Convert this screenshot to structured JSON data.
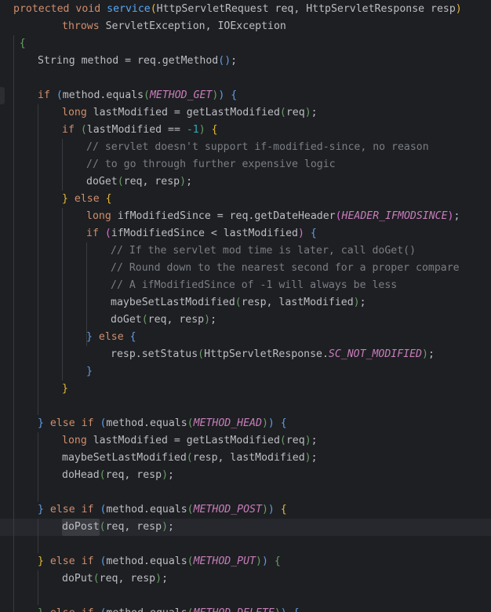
{
  "editor": {
    "language": "Java",
    "theme": "dark",
    "colors": {
      "background": "#1e1f22",
      "keyword": "#cf8e6d",
      "method_decl": "#56a8f5",
      "constant": "#c77dbb",
      "comment": "#7a7e85",
      "number": "#2aacb8",
      "text": "#bcbec4"
    },
    "caret_line": 31,
    "lines": [
      {
        "indent": 0,
        "tokens": [
          {
            "t": "protected",
            "s": "kw"
          },
          {
            "t": " ",
            "s": "tx"
          },
          {
            "t": "void",
            "s": "kw"
          },
          {
            "t": " ",
            "s": "tx"
          },
          {
            "t": "service",
            "s": "fn"
          },
          {
            "t": "(",
            "s": "b1"
          },
          {
            "t": "HttpServletRequest req, HttpServletResponse resp",
            "s": "tx"
          },
          {
            "t": ")",
            "s": "b1"
          }
        ]
      },
      {
        "indent": 8,
        "tokens": [
          {
            "t": "throws",
            "s": "kw"
          },
          {
            "t": " ServletException, IOException",
            "s": "tx"
          }
        ]
      },
      {
        "indent": 1,
        "tokens": [
          {
            "t": "{",
            "s": "b3"
          }
        ]
      },
      {
        "indent": 4,
        "tokens": [
          {
            "t": "String method = req.getMethod",
            "s": "tx"
          },
          {
            "t": "()",
            "s": "b2"
          },
          {
            "t": ";",
            "s": "tx"
          }
        ]
      },
      {
        "indent": 0,
        "tokens": []
      },
      {
        "indent": 4,
        "tokens": [
          {
            "t": "if",
            "s": "kw"
          },
          {
            "t": " ",
            "s": "tx"
          },
          {
            "t": "(",
            "s": "b2"
          },
          {
            "t": "method.equals",
            "s": "tx"
          },
          {
            "t": "(",
            "s": "b3"
          },
          {
            "t": "METHOD_GET",
            "s": "cn"
          },
          {
            "t": ")",
            "s": "b3"
          },
          {
            "t": ")",
            "s": "b2"
          },
          {
            "t": " ",
            "s": "tx"
          },
          {
            "t": "{",
            "s": "b2"
          }
        ]
      },
      {
        "indent": 8,
        "tokens": [
          {
            "t": "long",
            "s": "kw"
          },
          {
            "t": " lastModified = getLastModified",
            "s": "tx"
          },
          {
            "t": "(",
            "s": "b3"
          },
          {
            "t": "req",
            "s": "tx"
          },
          {
            "t": ")",
            "s": "b3"
          },
          {
            "t": ";",
            "s": "tx"
          }
        ]
      },
      {
        "indent": 8,
        "tokens": [
          {
            "t": "if",
            "s": "kw"
          },
          {
            "t": " ",
            "s": "tx"
          },
          {
            "t": "(",
            "s": "b3"
          },
          {
            "t": "lastModified == ",
            "s": "tx"
          },
          {
            "t": "-1",
            "s": "nm"
          },
          {
            "t": ")",
            "s": "b3"
          },
          {
            "t": " ",
            "s": "tx"
          },
          {
            "t": "{",
            "s": "b1"
          }
        ]
      },
      {
        "indent": 12,
        "tokens": [
          {
            "t": "// servlet doesn't support if-modified-since, no reason",
            "s": "cm"
          }
        ]
      },
      {
        "indent": 12,
        "tokens": [
          {
            "t": "// to go through further expensive logic",
            "s": "cm"
          }
        ]
      },
      {
        "indent": 12,
        "tokens": [
          {
            "t": "doGet",
            "s": "tx"
          },
          {
            "t": "(",
            "s": "b3"
          },
          {
            "t": "req, resp",
            "s": "tx"
          },
          {
            "t": ")",
            "s": "b3"
          },
          {
            "t": ";",
            "s": "tx"
          }
        ]
      },
      {
        "indent": 8,
        "tokens": [
          {
            "t": "}",
            "s": "b1"
          },
          {
            "t": " ",
            "s": "tx"
          },
          {
            "t": "else",
            "s": "kw"
          },
          {
            "t": " ",
            "s": "tx"
          },
          {
            "t": "{",
            "s": "b1"
          }
        ]
      },
      {
        "indent": 12,
        "tokens": [
          {
            "t": "long",
            "s": "kw"
          },
          {
            "t": " ifModifiedSince = req.getDateHeader",
            "s": "tx"
          },
          {
            "t": "(",
            "s": "b4"
          },
          {
            "t": "HEADER_IFMODSINCE",
            "s": "cn"
          },
          {
            "t": ")",
            "s": "b4"
          },
          {
            "t": ";",
            "s": "tx"
          }
        ]
      },
      {
        "indent": 12,
        "tokens": [
          {
            "t": "if",
            "s": "kw"
          },
          {
            "t": " ",
            "s": "tx"
          },
          {
            "t": "(",
            "s": "b4"
          },
          {
            "t": "ifModifiedSince < lastModified",
            "s": "tx"
          },
          {
            "t": ")",
            "s": "b4"
          },
          {
            "t": " ",
            "s": "tx"
          },
          {
            "t": "{",
            "s": "b2"
          }
        ]
      },
      {
        "indent": 16,
        "tokens": [
          {
            "t": "// If the servlet mod time is later, call doGet()",
            "s": "cm"
          }
        ]
      },
      {
        "indent": 16,
        "tokens": [
          {
            "t": "// Round down to the nearest second for a proper compare",
            "s": "cm"
          }
        ]
      },
      {
        "indent": 16,
        "tokens": [
          {
            "t": "// A ifModifiedSince of -1 will always be less",
            "s": "cm"
          }
        ]
      },
      {
        "indent": 16,
        "tokens": [
          {
            "t": "maybeSetLastModified",
            "s": "tx"
          },
          {
            "t": "(",
            "s": "b3"
          },
          {
            "t": "resp, lastModified",
            "s": "tx"
          },
          {
            "t": ")",
            "s": "b3"
          },
          {
            "t": ";",
            "s": "tx"
          }
        ]
      },
      {
        "indent": 16,
        "tokens": [
          {
            "t": "doGet",
            "s": "tx"
          },
          {
            "t": "(",
            "s": "b3"
          },
          {
            "t": "req, resp",
            "s": "tx"
          },
          {
            "t": ")",
            "s": "b3"
          },
          {
            "t": ";",
            "s": "tx"
          }
        ]
      },
      {
        "indent": 12,
        "tokens": [
          {
            "t": "}",
            "s": "b2"
          },
          {
            "t": " ",
            "s": "tx"
          },
          {
            "t": "else",
            "s": "kw"
          },
          {
            "t": " ",
            "s": "tx"
          },
          {
            "t": "{",
            "s": "b2"
          }
        ]
      },
      {
        "indent": 16,
        "tokens": [
          {
            "t": "resp.setStatus",
            "s": "tx"
          },
          {
            "t": "(",
            "s": "b3"
          },
          {
            "t": "HttpServletResponse.",
            "s": "tx"
          },
          {
            "t": "SC_NOT_MODIFIED",
            "s": "cn"
          },
          {
            "t": ")",
            "s": "b3"
          },
          {
            "t": ";",
            "s": "tx"
          }
        ]
      },
      {
        "indent": 12,
        "tokens": [
          {
            "t": "}",
            "s": "b2"
          }
        ]
      },
      {
        "indent": 8,
        "tokens": [
          {
            "t": "}",
            "s": "b1"
          }
        ]
      },
      {
        "indent": 0,
        "tokens": []
      },
      {
        "indent": 4,
        "tokens": [
          {
            "t": "}",
            "s": "b2"
          },
          {
            "t": " ",
            "s": "tx"
          },
          {
            "t": "else",
            "s": "kw"
          },
          {
            "t": " ",
            "s": "tx"
          },
          {
            "t": "if",
            "s": "kw"
          },
          {
            "t": " ",
            "s": "tx"
          },
          {
            "t": "(",
            "s": "b2"
          },
          {
            "t": "method.equals",
            "s": "tx"
          },
          {
            "t": "(",
            "s": "b3"
          },
          {
            "t": "METHOD_HEAD",
            "s": "cn"
          },
          {
            "t": ")",
            "s": "b3"
          },
          {
            "t": ")",
            "s": "b2"
          },
          {
            "t": " ",
            "s": "tx"
          },
          {
            "t": "{",
            "s": "b2"
          }
        ]
      },
      {
        "indent": 8,
        "tokens": [
          {
            "t": "long",
            "s": "kw"
          },
          {
            "t": " lastModified = getLastModified",
            "s": "tx"
          },
          {
            "t": "(",
            "s": "b3"
          },
          {
            "t": "req",
            "s": "tx"
          },
          {
            "t": ")",
            "s": "b3"
          },
          {
            "t": ";",
            "s": "tx"
          }
        ]
      },
      {
        "indent": 8,
        "tokens": [
          {
            "t": "maybeSetLastModified",
            "s": "tx"
          },
          {
            "t": "(",
            "s": "b3"
          },
          {
            "t": "resp, lastModified",
            "s": "tx"
          },
          {
            "t": ")",
            "s": "b3"
          },
          {
            "t": ";",
            "s": "tx"
          }
        ]
      },
      {
        "indent": 8,
        "tokens": [
          {
            "t": "doHead",
            "s": "tx"
          },
          {
            "t": "(",
            "s": "b3"
          },
          {
            "t": "req, resp",
            "s": "tx"
          },
          {
            "t": ")",
            "s": "b3"
          },
          {
            "t": ";",
            "s": "tx"
          }
        ]
      },
      {
        "indent": 0,
        "tokens": []
      },
      {
        "indent": 4,
        "tokens": [
          {
            "t": "}",
            "s": "b2"
          },
          {
            "t": " ",
            "s": "tx"
          },
          {
            "t": "else",
            "s": "kw"
          },
          {
            "t": " ",
            "s": "tx"
          },
          {
            "t": "if",
            "s": "kw"
          },
          {
            "t": " ",
            "s": "tx"
          },
          {
            "t": "(",
            "s": "b2"
          },
          {
            "t": "method.equals",
            "s": "tx"
          },
          {
            "t": "(",
            "s": "b3"
          },
          {
            "t": "METHOD_POST",
            "s": "cn"
          },
          {
            "t": ")",
            "s": "b3"
          },
          {
            "t": ")",
            "s": "b2"
          },
          {
            "t": " ",
            "s": "tx"
          },
          {
            "t": "{",
            "s": "b1"
          }
        ]
      },
      {
        "indent": 8,
        "tokens": [
          {
            "t": "doPost",
            "s": "tx hl"
          },
          {
            "t": "(",
            "s": "b3"
          },
          {
            "t": "req, resp",
            "s": "tx"
          },
          {
            "t": ")",
            "s": "b3"
          },
          {
            "t": ";",
            "s": "tx"
          }
        ]
      },
      {
        "indent": 0,
        "tokens": []
      },
      {
        "indent": 4,
        "tokens": [
          {
            "t": "}",
            "s": "b1"
          },
          {
            "t": " ",
            "s": "tx"
          },
          {
            "t": "else",
            "s": "kw"
          },
          {
            "t": " ",
            "s": "tx"
          },
          {
            "t": "if",
            "s": "kw"
          },
          {
            "t": " ",
            "s": "tx"
          },
          {
            "t": "(",
            "s": "b2"
          },
          {
            "t": "method.equals",
            "s": "tx"
          },
          {
            "t": "(",
            "s": "b3"
          },
          {
            "t": "METHOD_PUT",
            "s": "cn"
          },
          {
            "t": ")",
            "s": "b3"
          },
          {
            "t": ")",
            "s": "b2"
          },
          {
            "t": " ",
            "s": "tx"
          },
          {
            "t": "{",
            "s": "b3"
          }
        ]
      },
      {
        "indent": 8,
        "tokens": [
          {
            "t": "doPut",
            "s": "tx"
          },
          {
            "t": "(",
            "s": "b3"
          },
          {
            "t": "req, resp",
            "s": "tx"
          },
          {
            "t": ")",
            "s": "b3"
          },
          {
            "t": ";",
            "s": "tx"
          }
        ]
      },
      {
        "indent": 0,
        "tokens": []
      },
      {
        "indent": 4,
        "tokens": [
          {
            "t": "}",
            "s": "b3"
          },
          {
            "t": " ",
            "s": "tx"
          },
          {
            "t": "else",
            "s": "kw"
          },
          {
            "t": " ",
            "s": "tx"
          },
          {
            "t": "if",
            "s": "kw"
          },
          {
            "t": " ",
            "s": "tx"
          },
          {
            "t": "(",
            "s": "b2"
          },
          {
            "t": "method.equals",
            "s": "tx"
          },
          {
            "t": "(",
            "s": "b3"
          },
          {
            "t": "METHOD_DELETE",
            "s": "cn"
          },
          {
            "t": ")",
            "s": "b3"
          },
          {
            "t": ")",
            "s": "b2"
          },
          {
            "t": " ",
            "s": "tx"
          },
          {
            "t": "{",
            "s": "b2"
          }
        ]
      }
    ]
  }
}
